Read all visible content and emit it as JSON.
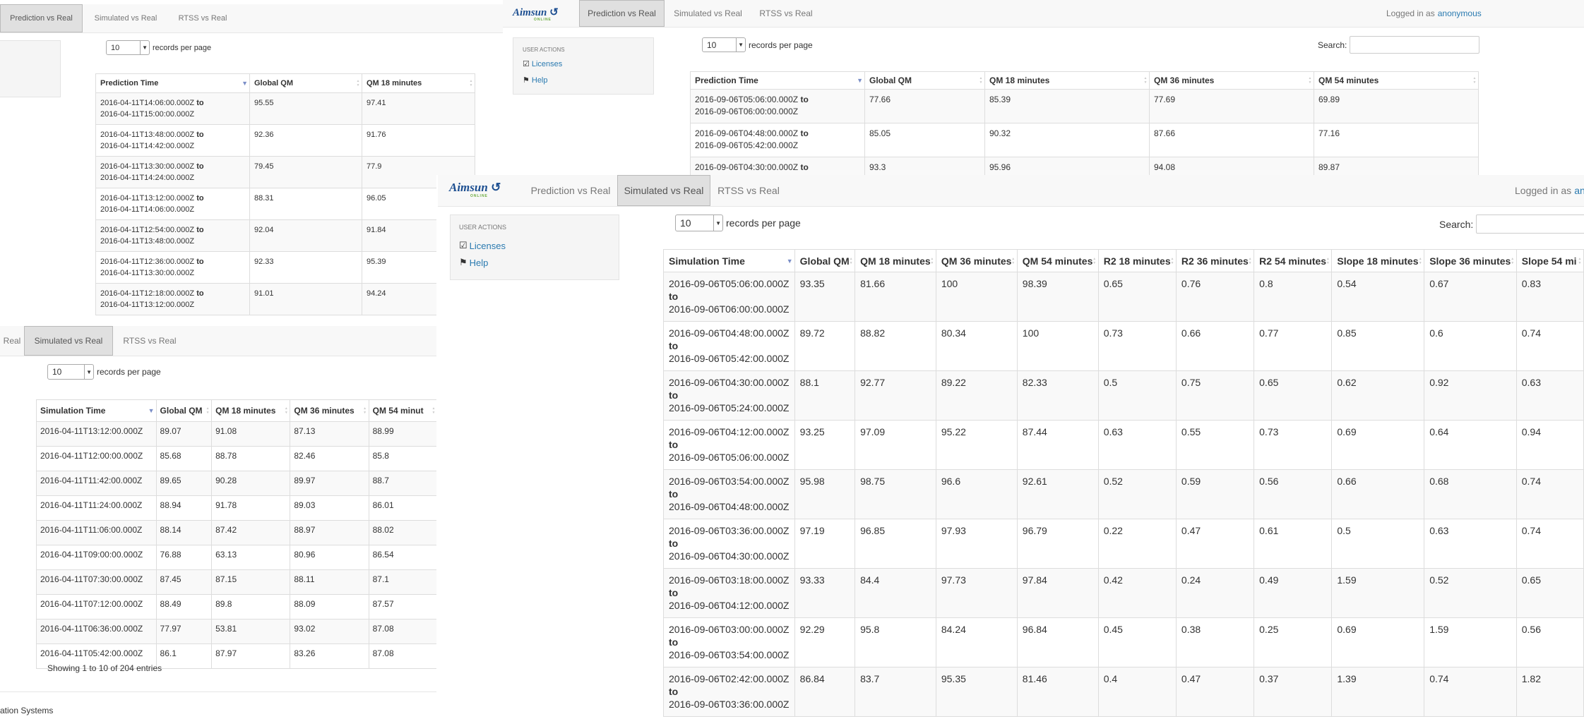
{
  "nav": {
    "tab_prediction": "Prediction vs Real",
    "tab_simulated": "Simulated vs Real",
    "tab_rtss": "RTSS vs Real",
    "tab_simulated_partial": "Real",
    "logged_in": "Logged in as",
    "user": "anonymous",
    "user_partial": "anon"
  },
  "logo": {
    "text": "Aimsun",
    "sub": "ONLINE"
  },
  "sidebar": {
    "header": "USER ACTIONS",
    "licenses": "Licenses",
    "help": "Help"
  },
  "length_menu": {
    "value": "10",
    "label": "records per page"
  },
  "search_label": "Search:",
  "panel_a": {
    "headers": [
      "Prediction Time",
      "Global QM",
      "QM 18 minutes"
    ],
    "rows": [
      [
        "2016-04-11T14:06:00.000Z",
        "to",
        "2016-04-11T15:00:00.000Z",
        "95.55",
        "97.41"
      ],
      [
        "2016-04-11T13:48:00.000Z",
        "to",
        "2016-04-11T14:42:00.000Z",
        "92.36",
        "91.76"
      ],
      [
        "2016-04-11T13:30:00.000Z",
        "to",
        "2016-04-11T14:24:00.000Z",
        "79.45",
        "77.9"
      ],
      [
        "2016-04-11T13:12:00.000Z",
        "to",
        "2016-04-11T14:06:00.000Z",
        "88.31",
        "96.05"
      ],
      [
        "2016-04-11T12:54:00.000Z",
        "to",
        "2016-04-11T13:48:00.000Z",
        "92.04",
        "91.84"
      ],
      [
        "2016-04-11T12:36:00.000Z",
        "to",
        "2016-04-11T13:30:00.000Z",
        "92.33",
        "95.39"
      ],
      [
        "2016-04-11T12:18:00.000Z",
        "to",
        "2016-04-11T13:12:00.000Z",
        "91.01",
        "94.24"
      ]
    ]
  },
  "panel_b": {
    "headers": [
      "Prediction Time",
      "Global QM",
      "QM 18 minutes",
      "QM 36 minutes",
      "QM 54 minutes"
    ],
    "rows": [
      [
        "2016-09-06T05:06:00.000Z",
        "to",
        "2016-09-06T06:00:00.000Z",
        "77.66",
        "85.39",
        "77.69",
        "69.89"
      ],
      [
        "2016-09-06T04:48:00.000Z",
        "to",
        "2016-09-06T05:42:00.000Z",
        "85.05",
        "90.32",
        "87.66",
        "77.16"
      ],
      [
        "2016-09-06T04:30:00.000Z",
        "to",
        "",
        "93.3",
        "95.96",
        "94.08",
        "89.87"
      ]
    ]
  },
  "panel_c": {
    "headers": [
      "Simulation Time",
      "Global QM",
      "QM 18 minutes",
      "QM 36 minutes",
      "QM 54 minut"
    ],
    "rows": [
      [
        "2016-04-11T13:12:00.000Z",
        "89.07",
        "91.08",
        "87.13",
        "88.99"
      ],
      [
        "2016-04-11T12:00:00.000Z",
        "85.68",
        "88.78",
        "82.46",
        "85.8"
      ],
      [
        "2016-04-11T11:42:00.000Z",
        "89.65",
        "90.28",
        "89.97",
        "88.7"
      ],
      [
        "2016-04-11T11:24:00.000Z",
        "88.94",
        "91.78",
        "89.03",
        "86.01"
      ],
      [
        "2016-04-11T11:06:00.000Z",
        "88.14",
        "87.42",
        "88.97",
        "88.02"
      ],
      [
        "2016-04-11T09:00:00.000Z",
        "76.88",
        "63.13",
        "80.96",
        "86.54"
      ],
      [
        "2016-04-11T07:30:00.000Z",
        "87.45",
        "87.15",
        "88.11",
        "87.1"
      ],
      [
        "2016-04-11T07:12:00.000Z",
        "88.49",
        "89.8",
        "88.09",
        "87.57"
      ],
      [
        "2016-04-11T06:36:00.000Z",
        "77.97",
        "53.81",
        "93.02",
        "87.08"
      ],
      [
        "2016-04-11T05:42:00.000Z",
        "86.1",
        "87.97",
        "83.26",
        "87.08"
      ]
    ],
    "showing": "Showing 1 to 10 of 204 entries",
    "footer": "ation Systems"
  },
  "panel_d": {
    "headers": [
      "Simulation Time",
      "Global QM",
      "QM 18 minutes",
      "QM 36 minutes",
      "QM 54 minutes",
      "R2 18 minutes",
      "R2 36 minutes",
      "R2 54 minutes",
      "Slope 18 minutes",
      "Slope 36 minutes",
      "Slope 54 mi"
    ],
    "rows": [
      [
        "2016-09-06T05:06:00.000Z",
        "to",
        "2016-09-06T06:00:00.000Z",
        "93.35",
        "81.66",
        "100",
        "98.39",
        "0.65",
        "0.76",
        "0.8",
        "0.54",
        "0.67",
        "0.83"
      ],
      [
        "2016-09-06T04:48:00.000Z",
        "to",
        "2016-09-06T05:42:00.000Z",
        "89.72",
        "88.82",
        "80.34",
        "100",
        "0.73",
        "0.66",
        "0.77",
        "0.85",
        "0.6",
        "0.74"
      ],
      [
        "2016-09-06T04:30:00.000Z",
        "to",
        "2016-09-06T05:24:00.000Z",
        "88.1",
        "92.77",
        "89.22",
        "82.33",
        "0.5",
        "0.75",
        "0.65",
        "0.62",
        "0.92",
        "0.63"
      ],
      [
        "2016-09-06T04:12:00.000Z",
        "to",
        "2016-09-06T05:06:00.000Z",
        "93.25",
        "97.09",
        "95.22",
        "87.44",
        "0.63",
        "0.55",
        "0.73",
        "0.69",
        "0.64",
        "0.94"
      ],
      [
        "2016-09-06T03:54:00.000Z",
        "to",
        "2016-09-06T04:48:00.000Z",
        "95.98",
        "98.75",
        "96.6",
        "92.61",
        "0.52",
        "0.59",
        "0.56",
        "0.66",
        "0.68",
        "0.74"
      ],
      [
        "2016-09-06T03:36:00.000Z",
        "to",
        "2016-09-06T04:30:00.000Z",
        "97.19",
        "96.85",
        "97.93",
        "96.79",
        "0.22",
        "0.47",
        "0.61",
        "0.5",
        "0.63",
        "0.74"
      ],
      [
        "2016-09-06T03:18:00.000Z",
        "to",
        "2016-09-06T04:12:00.000Z",
        "93.33",
        "84.4",
        "97.73",
        "97.84",
        "0.42",
        "0.24",
        "0.49",
        "1.59",
        "0.52",
        "0.65"
      ],
      [
        "2016-09-06T03:00:00.000Z",
        "to",
        "2016-09-06T03:54:00.000Z",
        "92.29",
        "95.8",
        "84.24",
        "96.84",
        "0.45",
        "0.38",
        "0.25",
        "0.69",
        "1.59",
        "0.56"
      ],
      [
        "2016-09-06T02:42:00.000Z",
        "to",
        "2016-09-06T03:36:00.000Z",
        "86.84",
        "83.7",
        "95.35",
        "81.46",
        "0.4",
        "0.47",
        "0.37",
        "1.39",
        "0.74",
        "1.82"
      ]
    ]
  }
}
